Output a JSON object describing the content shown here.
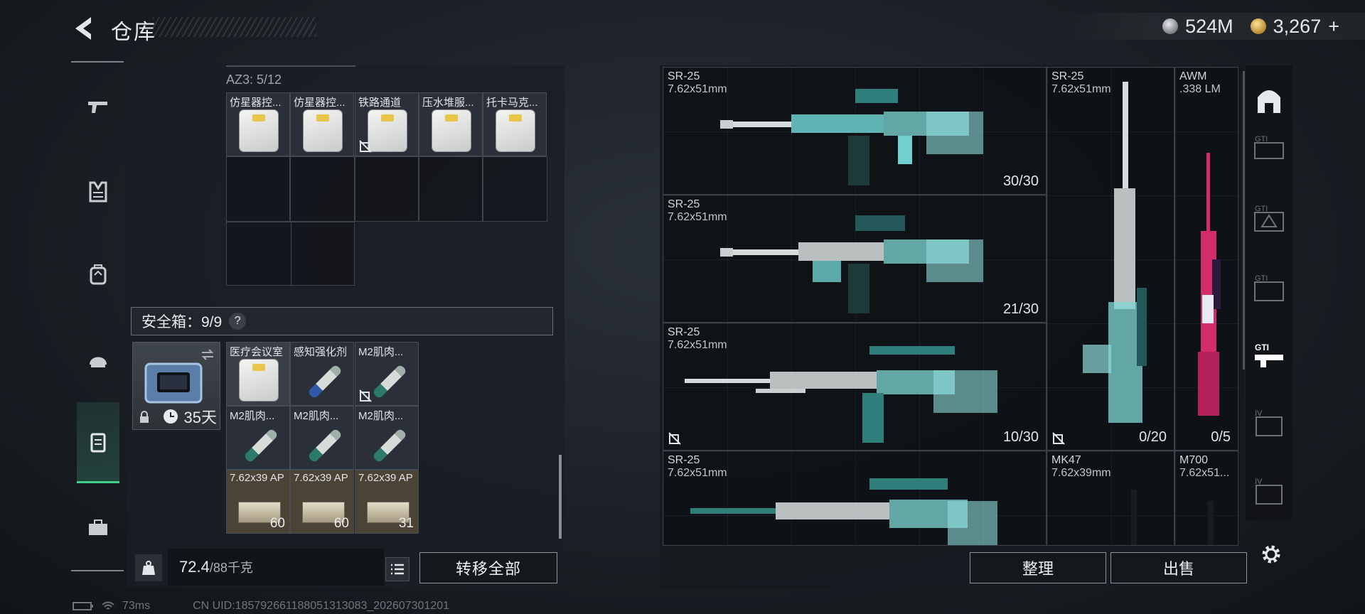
{
  "header": {
    "title": "仓库",
    "currency_silver": "524M",
    "currency_gold": "3,267",
    "gold_plus": "+"
  },
  "stash": {
    "az_label": "AZ3: 5/12",
    "items": [
      {
        "name": "仿星器控..."
      },
      {
        "name": "仿星器控..."
      },
      {
        "name": "铁路通道"
      },
      {
        "name": "压水堆服..."
      },
      {
        "name": "托卡马克..."
      }
    ]
  },
  "safe": {
    "label": "安全箱：9/9",
    "help": "?",
    "case_days": "35天",
    "items": [
      {
        "name": "医疗会议室",
        "count": ""
      },
      {
        "name": "感知强化剂",
        "count": ""
      },
      {
        "name": "M2肌肉...",
        "count": ""
      },
      {
        "name": "M2肌肉...",
        "count": ""
      },
      {
        "name": "M2肌肉...",
        "count": ""
      },
      {
        "name": "M2肌肉...",
        "count": ""
      },
      {
        "name": "7.62x39 AP",
        "count": "60"
      },
      {
        "name": "7.62x39 AP",
        "count": "60"
      },
      {
        "name": "7.62x39 AP",
        "count": "31"
      }
    ]
  },
  "footer": {
    "weight": "72.4",
    "weight_max": "/88千克",
    "transfer_all": "转移全部",
    "ping": "73ms",
    "uid": "CN UID:1857926611880513130​83_202607301201"
  },
  "weapons": [
    {
      "name": "SR-25",
      "caliber": "7.62x51mm",
      "ammo": "30/30"
    },
    {
      "name": "SR-25",
      "caliber": "7.62x51mm",
      "ammo": "21/30"
    },
    {
      "name": "SR-25",
      "caliber": "7.62x51mm",
      "ammo": "10/30"
    },
    {
      "name": "SR-25",
      "caliber": "7.62x51mm",
      "ammo": ""
    },
    {
      "name": "SR-25",
      "caliber": "7.62x51mm",
      "ammo": "0/20"
    },
    {
      "name": "AWM",
      "caliber": ".338 LM",
      "ammo": "0/5"
    },
    {
      "name": "MK47",
      "caliber": "7.62x39mm",
      "ammo": ""
    },
    {
      "name": "M700",
      "caliber": "7.62x51...",
      "ammo": ""
    }
  ],
  "actions": {
    "sort": "整理",
    "sell": "出售"
  },
  "colors": {
    "accent": "#3fcf8e",
    "teal_camo": "#6fd0cf",
    "awm_pink": "#d42c6a"
  }
}
